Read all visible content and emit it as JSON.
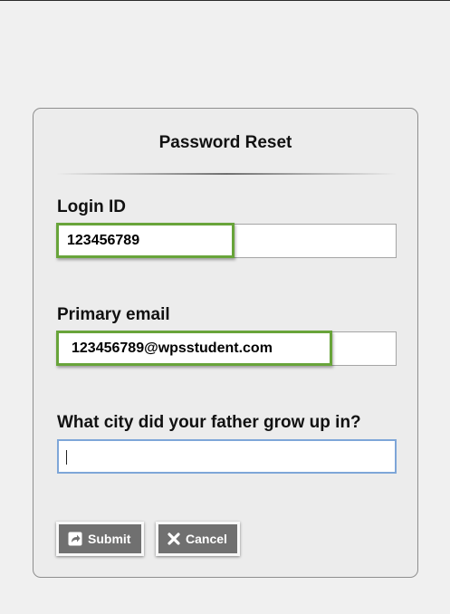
{
  "form": {
    "title": "Password Reset",
    "login_id": {
      "label": "Login ID",
      "value": "123456789"
    },
    "primary_email": {
      "label": "Primary email",
      "value": "123456789@wpsstudent.com"
    },
    "security_question": {
      "label": "What city did your father grow up in?",
      "value": ""
    },
    "buttons": {
      "submit": "Submit",
      "cancel": "Cancel"
    }
  },
  "colors": {
    "highlight_border": "#68a43a",
    "focus_border": "#7ea6d8",
    "button_bg": "#707070"
  },
  "icons": {
    "submit": "share-arrow-icon",
    "cancel": "x-icon"
  }
}
